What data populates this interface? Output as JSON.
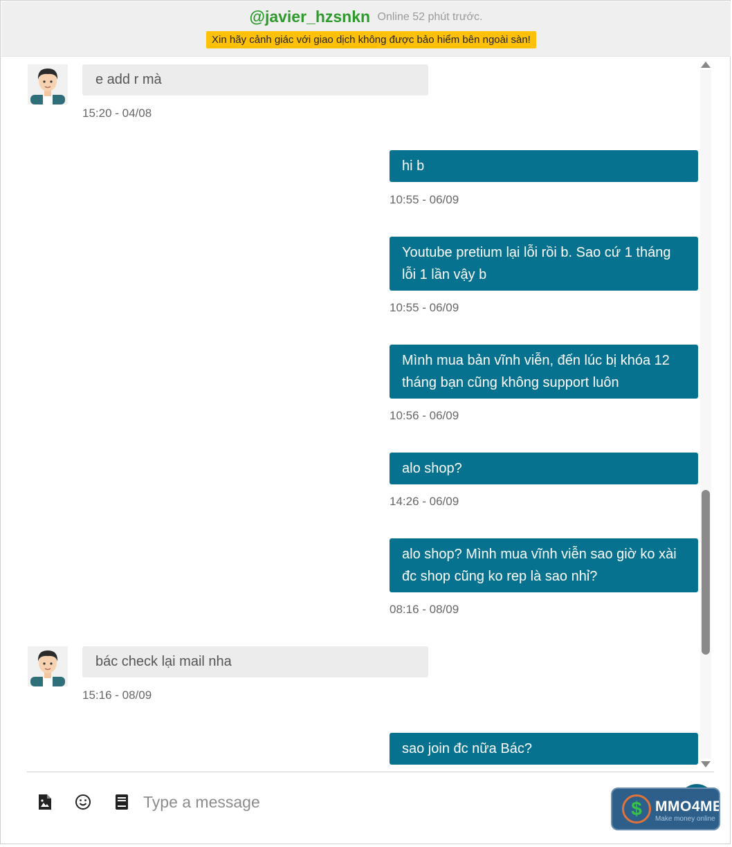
{
  "header": {
    "username": "@javier_hzsnkn",
    "online_status": "Online 52 phút trước.",
    "warning": "Xin hãy cảnh giác với giao dịch không được bảo hiểm bên ngoài sàn!"
  },
  "messages": [
    {
      "direction": "in",
      "text": "e add r mà",
      "time": "15:20 - 04/08"
    },
    {
      "direction": "out",
      "text": "hi b",
      "time": "10:55 - 06/09"
    },
    {
      "direction": "out",
      "text": "Youtube pretium lại lỗi rồi b. Sao cứ 1 tháng lỗi 1 lần vậy b",
      "time": "10:55 - 06/09"
    },
    {
      "direction": "out",
      "text": "Mình mua bản vĩnh viễn, đến lúc bị khóa 12 tháng bạn cũng không support luôn",
      "time": "10:56 - 06/09"
    },
    {
      "direction": "out",
      "text": "alo shop?",
      "time": "14:26 - 06/09"
    },
    {
      "direction": "out",
      "text": "alo shop? Mình mua vĩnh viễn sao giờ ko xài đc shop cũng ko rep là sao nhỉ?",
      "time": "08:16 - 08/09"
    },
    {
      "direction": "in",
      "text": "bác check lại mail nha",
      "time": "15:16 - 08/09"
    },
    {
      "direction": "out",
      "text": "sao join đc nữa Bác?",
      "time": ""
    }
  ],
  "composer": {
    "placeholder": "Type a message",
    "icons": [
      "image-upload-icon",
      "emoji-icon",
      "book-icon",
      "send-icon"
    ]
  },
  "brand": {
    "name": "MMO4ME",
    "tagline": "Make money online"
  },
  "colors": {
    "username": "#2f9a2c",
    "warning_bg": "#ffc107",
    "outgoing_bubble": "#06728f",
    "incoming_bubble": "#ececec"
  }
}
